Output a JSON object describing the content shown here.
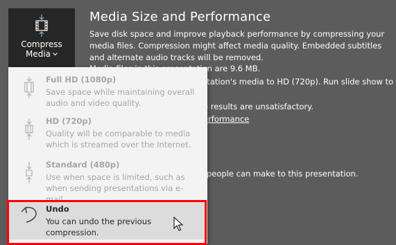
{
  "ribbon": {
    "compress_button": {
      "label_line1": "Compress",
      "label_line2": "Media",
      "icon": "film-compress-icon",
      "chevron_icon": "chevron-down-icon"
    }
  },
  "info": {
    "title": "Media Size and Performance",
    "description": "Save disk space and improve playback performance by compressing your media files. Compression might affect media quality. Embedded subtitles and alternate audio tracks will be removed.",
    "partial_lines": {
      "media_size": "Media files in this presentation are 9.6 MB.",
      "optimize": "entation's media to HD (720p). Run slide show to",
      "unsatisfactory": "e results are unsatisfactory.",
      "link_performance": "erformance",
      "changes": "people can make to this presentation."
    }
  },
  "menu": {
    "items": [
      {
        "title": "Full HD (1080p)",
        "description": "Save space while maintaining overall audio and video quality.",
        "icon": "film-compress-icon",
        "enabled": false
      },
      {
        "title": "HD (720p)",
        "description": "Quality will be comparable to media which is streamed over the Internet.",
        "icon": "film-compress-icon",
        "enabled": false
      },
      {
        "title": "Standard (480p)",
        "description": "Use when space is limited, such as when sending presentations via e-mail.",
        "icon": "film-compress-icon",
        "enabled": false
      },
      {
        "title": "Undo",
        "description": "You can undo the previous compression.",
        "icon": "undo-icon",
        "enabled": true
      }
    ]
  },
  "colors": {
    "background": "#5c5c5c",
    "button_bg": "#262626",
    "menu_bg": "#f3f3f3",
    "hover_bg": "#dcdcdc",
    "disabled_text": "#a6a6a6",
    "highlight": "#ff0000"
  }
}
